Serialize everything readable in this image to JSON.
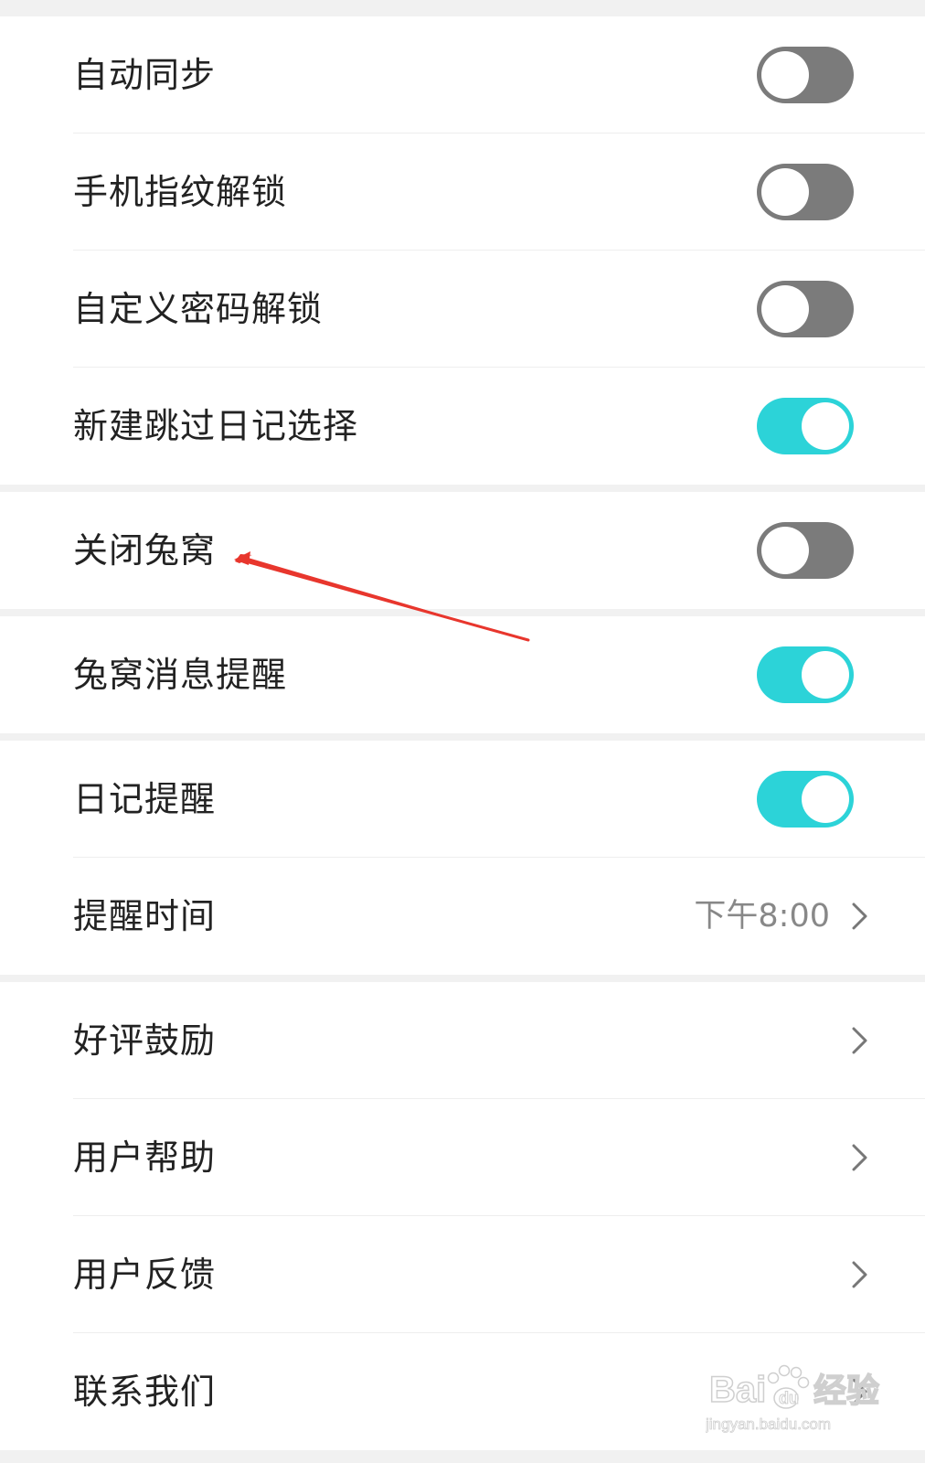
{
  "colors": {
    "page_background": "#f1f1f1",
    "card_background": "#ffffff",
    "toggle_on": "#2cd3d8",
    "toggle_off": "#7b7b7b",
    "text_primary": "#222222",
    "text_secondary": "#888888",
    "annotation_arrow": "#e8362d"
  },
  "settings": {
    "group1": [
      {
        "label": "自动同步",
        "type": "toggle",
        "on": false
      },
      {
        "label": "手机指纹解锁",
        "type": "toggle",
        "on": false
      },
      {
        "label": "自定义密码解锁",
        "type": "toggle",
        "on": false
      },
      {
        "label": "新建跳过日记选择",
        "type": "toggle",
        "on": true
      }
    ],
    "group2": [
      {
        "label": "关闭兔窝",
        "type": "toggle",
        "on": false
      }
    ],
    "group3": [
      {
        "label": "兔窝消息提醒",
        "type": "toggle",
        "on": true
      }
    ],
    "group4": [
      {
        "label": "日记提醒",
        "type": "toggle",
        "on": true
      },
      {
        "label": "提醒时间",
        "type": "link",
        "value": "下午8:00",
        "icon": "chevron-right-icon"
      }
    ],
    "group5": [
      {
        "label": "好评鼓励",
        "type": "link",
        "icon": "chevron-right-icon"
      },
      {
        "label": "用户帮助",
        "type": "link",
        "icon": "chevron-right-icon"
      },
      {
        "label": "用户反馈",
        "type": "link",
        "icon": "chevron-right-icon"
      },
      {
        "label": "联系我们",
        "type": "link",
        "icon": "chevron-right-icon"
      }
    ]
  },
  "annotation": {
    "type": "arrow",
    "target": "关闭兔窝",
    "icon": "red-arrow-icon"
  },
  "watermark": {
    "brand": "Bai du 经验",
    "url": "jingyan.baidu.com",
    "icon": "baidu-paw-icon"
  }
}
